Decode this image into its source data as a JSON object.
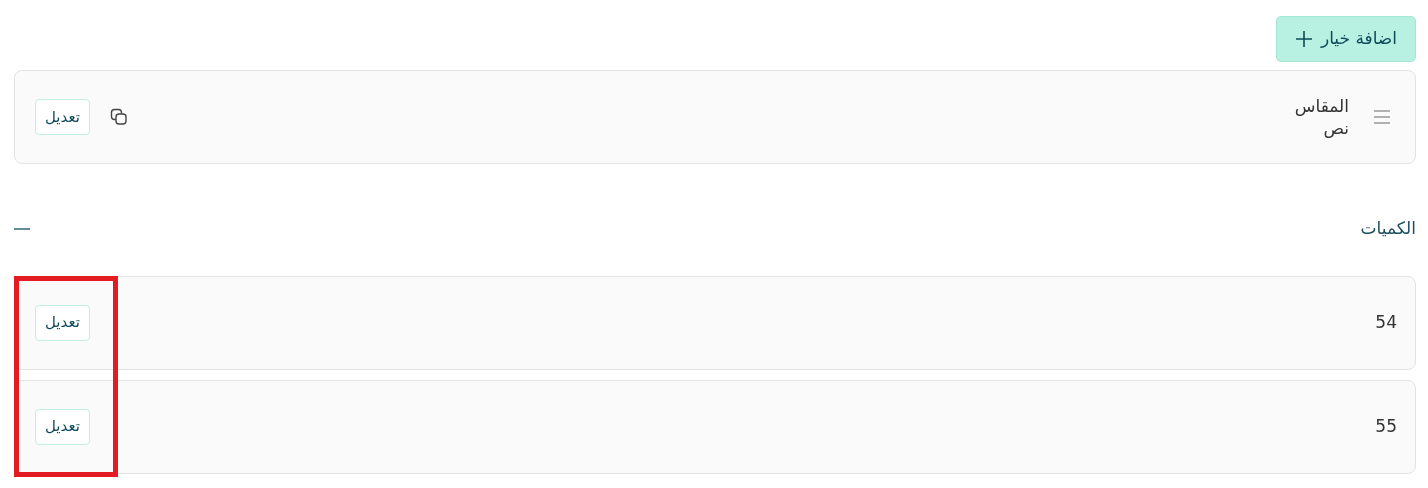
{
  "add_option_button": {
    "label": "اضافة خيار"
  },
  "option": {
    "name": "المقاس",
    "type": "نص",
    "edit_label": "تعديل"
  },
  "quantities": {
    "title": "الكميات",
    "expanded": true,
    "edit_column_highlighted": true,
    "rows": [
      {
        "value": "54",
        "edit_label": "تعديل"
      },
      {
        "value": "55",
        "edit_label": "تعديل"
      }
    ]
  }
}
